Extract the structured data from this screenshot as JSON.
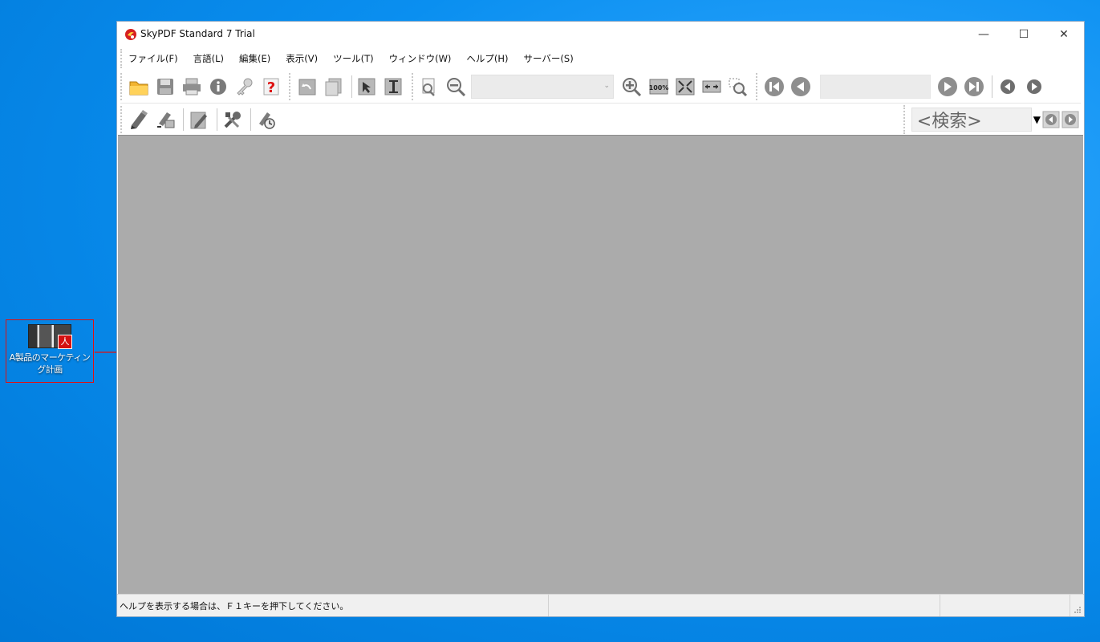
{
  "desktop": {
    "icon_label": "A製品のマーケティング計画",
    "icon_badge": "人"
  },
  "window": {
    "title": "SkyPDF Standard 7 Trial",
    "controls": {
      "minimize": "—",
      "maximize": "☐",
      "close": "✕"
    }
  },
  "menu": {
    "items": [
      "ファイル(F)",
      "言語(L)",
      "編集(E)",
      "表示(V)",
      "ツール(T)",
      "ウィンドウ(W)",
      "ヘルプ(H)",
      "サーバー(S)"
    ]
  },
  "toolbar": {
    "zoom_value": "",
    "page_value": "",
    "zoom_dropdown_glyph": "⌄"
  },
  "search": {
    "placeholder": "<検索>",
    "dropdown_glyph": "▼"
  },
  "status": {
    "message": "ヘルプを表示する場合は、Ｆ１キーを押下してください。"
  },
  "colors": {
    "desktop": "#0a8ff0",
    "document_area": "#ababab",
    "highlight": "#e01010"
  }
}
